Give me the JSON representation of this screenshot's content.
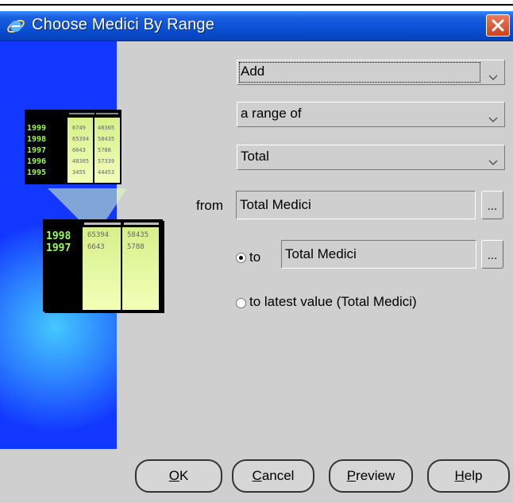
{
  "window": {
    "title": "Choose Medici By Range",
    "title_icon": "internet-explorer-icon",
    "close_icon": "close-icon"
  },
  "form": {
    "action_select": {
      "value": "Add"
    },
    "range_select": {
      "value": "a range of"
    },
    "measure_select": {
      "value": "Total"
    },
    "from_label": "from",
    "from_value": "Total Medici",
    "from_browse": "...",
    "to_label": "to",
    "to_value": "Total Medici",
    "to_browse": "...",
    "to_selected": true,
    "latest_label": "to latest value (Total Medici)"
  },
  "buttons": {
    "ok": {
      "mnemonic": "O",
      "rest": "K"
    },
    "cancel": {
      "mnemonic": "C",
      "rest": "ancel"
    },
    "preview": {
      "mnemonic": "P",
      "rest": "review"
    },
    "help": {
      "mnemonic": "H",
      "rest": "elp"
    }
  },
  "artwork": {
    "small_table": {
      "years": [
        "1999",
        "1998",
        "1997",
        "1996",
        "1995"
      ],
      "col1": [
        "6749",
        "65394",
        "6643",
        "48305",
        "3455"
      ],
      "col2": [
        "48305",
        "58435",
        "5788",
        "57339",
        "44453"
      ]
    },
    "large_table": {
      "years": [
        "1998",
        "1997"
      ],
      "col1": [
        "65394",
        "6643"
      ],
      "col2": [
        "58435",
        "5788"
      ]
    }
  },
  "colors": {
    "titlebar": "#0a4fd6",
    "dialog_bg": "#cfcfcf",
    "artwork_blue": "#1238ff",
    "close_red": "#d8552f"
  }
}
